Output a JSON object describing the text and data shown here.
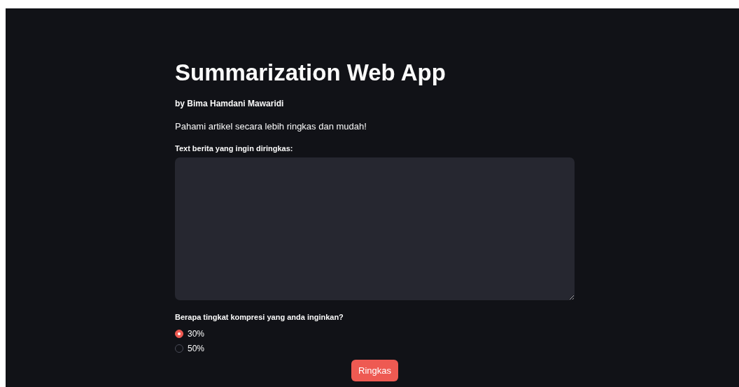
{
  "title": "Summarization Web App",
  "author": "by Bima Hamdani Mawaridi",
  "description": "Pahami artikel secara lebih ringkas dan mudah!",
  "text_input": {
    "label": "Text berita yang ingin diringkas:"
  },
  "compression": {
    "label": "Berapa tingkat kompresi yang anda inginkan?",
    "options": [
      {
        "label": "30%",
        "selected": true
      },
      {
        "label": "50%",
        "selected": false
      }
    ]
  },
  "button": {
    "label": "Ringkas"
  }
}
